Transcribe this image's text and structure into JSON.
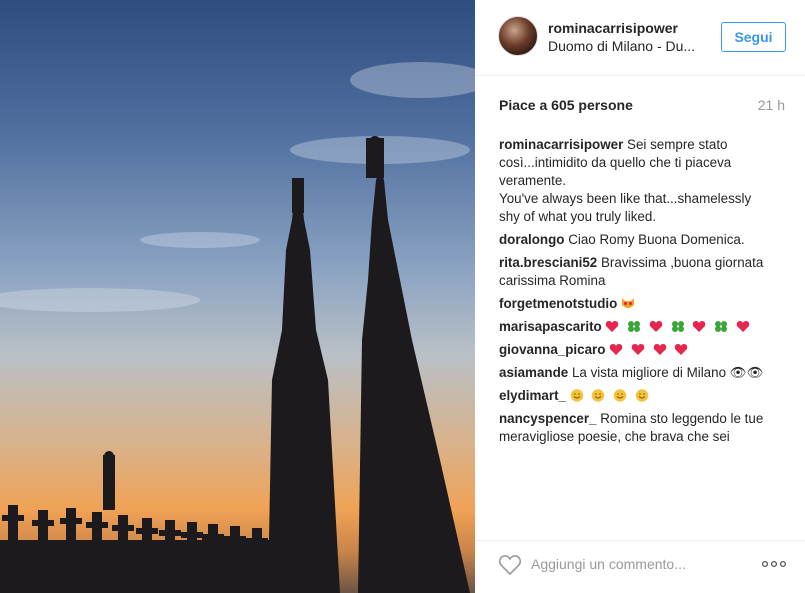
{
  "post": {
    "author": "rominacarrisipower",
    "location": "Duomo di Milano - Du...",
    "follow_label": "Segui",
    "likes": "Piace a 605 persone",
    "time": "21 h"
  },
  "caption": {
    "user": "rominacarrisipower",
    "lines": [
      "Sei sempre stato",
      "così...intimidito da quello che ti piaceva",
      "veramente.",
      "You've always been like that...shamelessly",
      "shy of what you truly liked."
    ]
  },
  "comments": [
    {
      "user": "doralongo",
      "text": "Ciao Romy Buona Domenica."
    },
    {
      "user": "rita.bresciani52",
      "text": "Bravissima ,buona giornata",
      "text2": "carissima Romina"
    },
    {
      "user": "forgetmenotstudio",
      "emojis": [
        "heart-eyes-cat"
      ]
    },
    {
      "user": "marisapascarito",
      "emojis": [
        "heart",
        "clover",
        "heart",
        "clover",
        "heart",
        "clover",
        "heart"
      ]
    },
    {
      "user": "giovanna_picaro",
      "emojis": [
        "heart",
        "heart",
        "heart",
        "heart"
      ]
    },
    {
      "user": "asiamande",
      "text": "La vista migliore di Milano 👁👁"
    },
    {
      "user": "elydimart_",
      "emojis": [
        "smile",
        "smile",
        "smile",
        "smile"
      ]
    },
    {
      "user": "nancyspencer_",
      "text": "Romina sto leggendo le tue",
      "text2": "meravigliose poesie, che brava che sei"
    }
  ],
  "add_comment": {
    "placeholder": "Aggiungi un commento..."
  },
  "colors": {
    "accent": "#3897f0",
    "text": "#262626",
    "muted": "#999999",
    "heart_emoji": "#e8254e",
    "clover_emoji": "#3aa63a",
    "smile_emoji": "#f5c33b"
  },
  "icons": [
    "heart-icon",
    "more-options-icon"
  ]
}
